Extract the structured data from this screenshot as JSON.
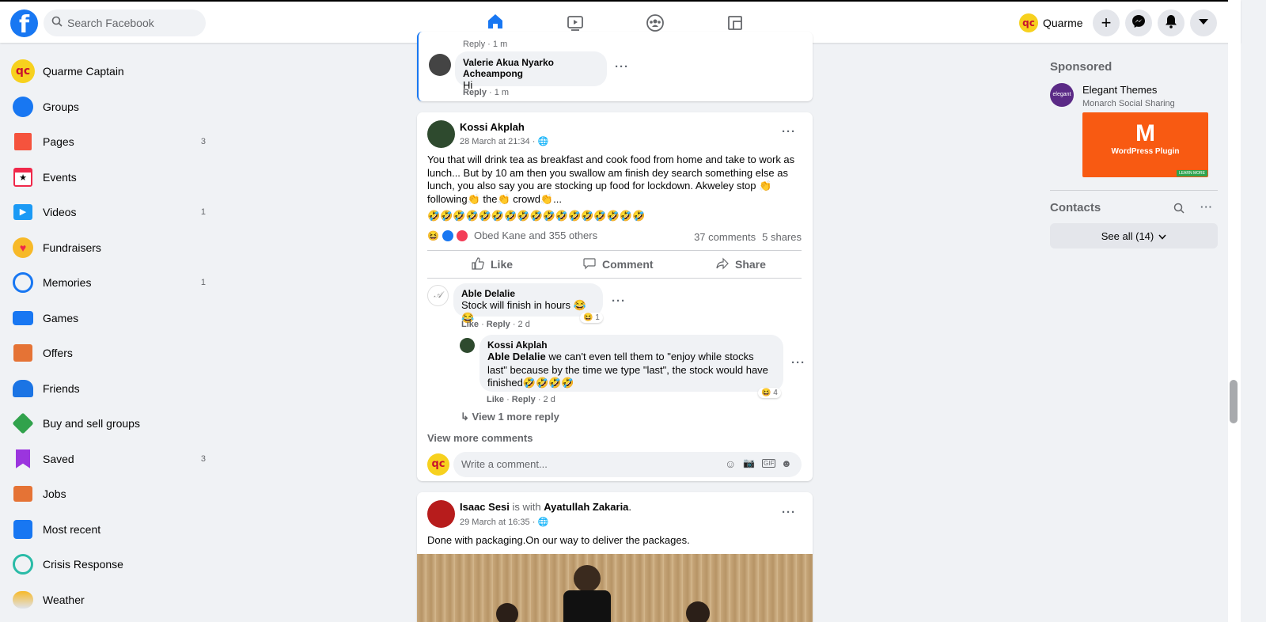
{
  "topbar": {
    "search_placeholder": "Search Facebook",
    "profile_name": "Quarme",
    "profile_initials": "qc"
  },
  "left_nav": [
    {
      "label": "Quarme Captain",
      "icon": "profile-avatar-icon",
      "count": ""
    },
    {
      "label": "Groups",
      "icon": "groups-icon",
      "count": ""
    },
    {
      "label": "Pages",
      "icon": "flag-icon",
      "count": "3"
    },
    {
      "label": "Events",
      "icon": "calendar-star-icon",
      "count": ""
    },
    {
      "label": "Videos",
      "icon": "play-icon",
      "count": "1"
    },
    {
      "label": "Fundraisers",
      "icon": "heart-icon",
      "count": ""
    },
    {
      "label": "Memories",
      "icon": "clock-icon",
      "count": "1"
    },
    {
      "label": "Games",
      "icon": "gamepad-icon",
      "count": ""
    },
    {
      "label": "Offers",
      "icon": "tag-icon",
      "count": ""
    },
    {
      "label": "Friends",
      "icon": "friends-icon",
      "count": ""
    },
    {
      "label": "Buy and sell groups",
      "icon": "price-tag-icon",
      "count": ""
    },
    {
      "label": "Saved",
      "icon": "bookmark-icon",
      "count": "3"
    },
    {
      "label": "Jobs",
      "icon": "briefcase-icon",
      "count": ""
    },
    {
      "label": "Most recent",
      "icon": "recent-calendar-icon",
      "count": ""
    },
    {
      "label": "Crisis Response",
      "icon": "crisis-icon",
      "count": ""
    },
    {
      "label": "Weather",
      "icon": "weather-icon",
      "count": ""
    }
  ],
  "prev_card": {
    "top_meta": "Reply · 1 m",
    "comment_name": "Valerie Akua Nyarko Acheampong",
    "comment_text": "Hi",
    "meta_reply": "Reply",
    "meta_time": " · 1 m"
  },
  "post1": {
    "author": "Kossi Akplah",
    "date": "28 March at 21:34 · ",
    "body": "You that will drink tea as breakfast and cook food from home and take to work as lunch... But by 10 am then you swallow am finish dey search something else as lunch, you also say you are stocking up food for lockdown. Akweley stop 👏 following👏 the👏 crowd👏...",
    "emoji_line": "🤣🤣🤣🤣🤣🤣🤣🤣🤣🤣🤣🤣🤣🤣🤣🤣🤣",
    "reactions": "Obed Kane and 355 others",
    "comments_count": "37 comments",
    "shares_count": "5 shares",
    "like": "Like",
    "comment": "Comment",
    "share": "Share",
    "c1_name": "Able Delalie",
    "c1_text": "Stock will finish in hours 😂😂",
    "c1_react": "1",
    "c1_like": "Like",
    "c1_reply": "Reply",
    "c1_time": " · 2 d",
    "r1_name": "Kossi Akplah",
    "r1_mention": "Able Delalie",
    "r1_text": " we can't even tell them to \"enjoy while stocks last\" because by the time we type \"last\", the stock would have finished🤣🤣🤣🤣",
    "r1_react": "4",
    "r1_like": "Like",
    "r1_reply": "Reply",
    "r1_time": " · 2 d",
    "view_more_reply": "View 1 more reply",
    "view_more_comments": "View more comments",
    "write_placeholder": "Write a comment..."
  },
  "post2": {
    "author": "Isaac Sesi",
    "with_text": " is with ",
    "tagged": "Ayatullah Zakaria",
    "period": ".",
    "date": "29 March at 16:35 · ",
    "body": "Done with packaging.On our way to deliver the packages."
  },
  "sponsored": {
    "title": "Sponsored",
    "advertiser": "Elegant Themes",
    "subtitle": "Monarch Social Sharing",
    "logo_text": "elegant",
    "ad_letter": "M",
    "ad_caption": "WordPress Plugin",
    "ad_button": "LEARN MORE"
  },
  "contacts": {
    "title": "Contacts",
    "see_all": "See all (14)"
  }
}
